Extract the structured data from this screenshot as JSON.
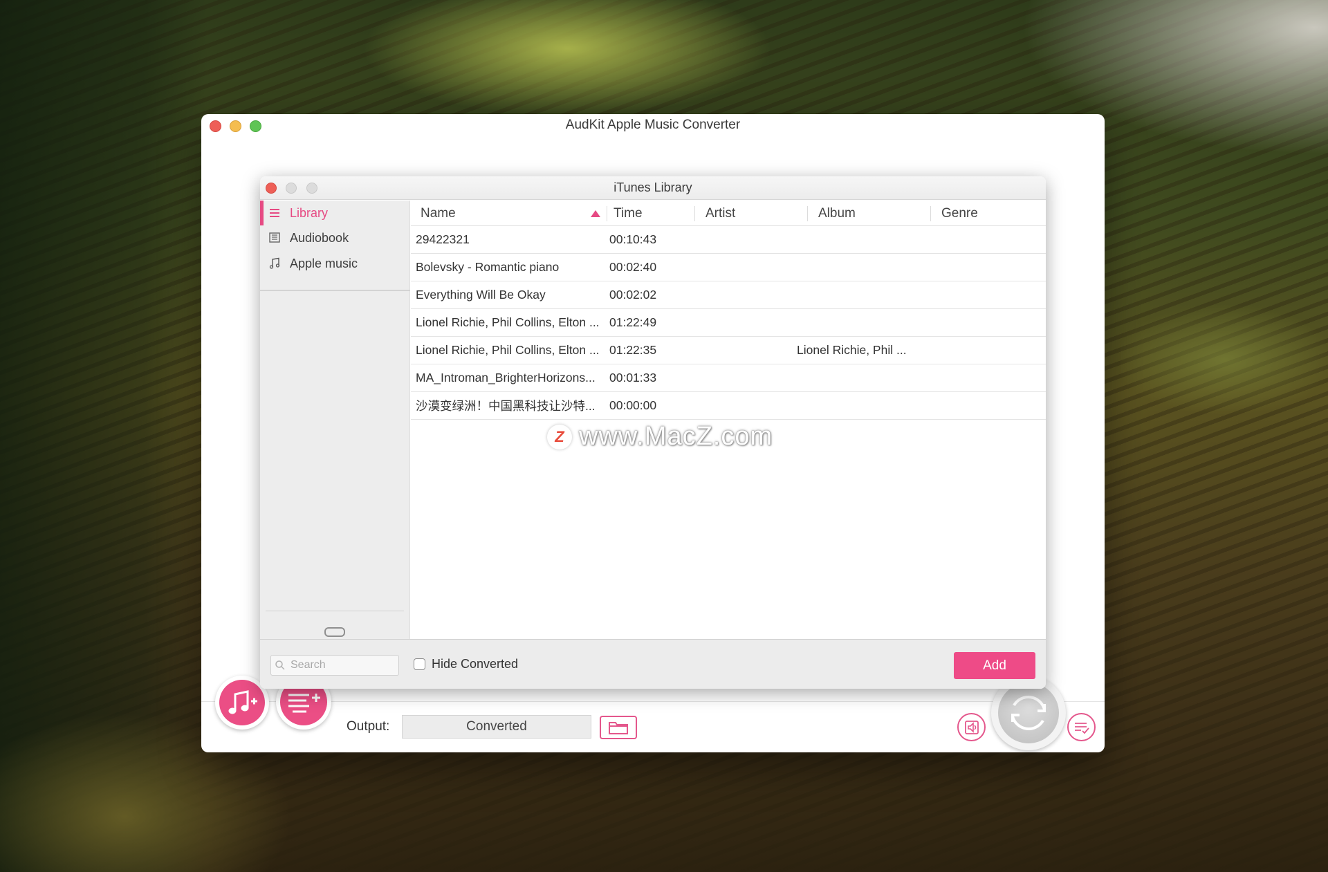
{
  "main_window": {
    "title": "AudKit Apple Music Converter",
    "output_label": "Output:",
    "output_value": "Converted"
  },
  "dialog": {
    "title": "iTunes Library",
    "sidebar": [
      {
        "label": "Library",
        "icon": "list-icon",
        "active": true
      },
      {
        "label": "Audiobook",
        "icon": "book-icon",
        "active": false
      },
      {
        "label": "Apple music",
        "icon": "music-note-icon",
        "active": false
      }
    ],
    "columns": [
      "Name",
      "Time",
      "Artist",
      "Album",
      "Genre"
    ],
    "sort": {
      "column": "Name",
      "direction": "ascending"
    },
    "rows": [
      {
        "name": "29422321",
        "time": "00:10:43",
        "artist": "",
        "album": "",
        "genre": ""
      },
      {
        "name": "Bolevsky - Romantic piano",
        "time": "00:02:40",
        "artist": "",
        "album": "",
        "genre": ""
      },
      {
        "name": "Everything Will Be Okay",
        "time": "00:02:02",
        "artist": "",
        "album": "",
        "genre": ""
      },
      {
        "name": "Lionel Richie, Phil Collins, Elton ...",
        "time": "01:22:49",
        "artist": "",
        "album": "",
        "genre": ""
      },
      {
        "name": "Lionel Richie, Phil Collins, Elton ...",
        "time": "01:22:35",
        "artist": "",
        "album": "Lionel Richie, Phil ...",
        "genre": ""
      },
      {
        "name": "MA_Introman_BrighterHorizons...",
        "time": "00:01:33",
        "artist": "",
        "album": "",
        "genre": ""
      },
      {
        "name": "沙漠变绿洲！中国黑科技让沙特...",
        "time": "00:00:00",
        "artist": "",
        "album": "",
        "genre": ""
      }
    ],
    "search_placeholder": "Search",
    "hide_converted_label": "Hide Converted",
    "hide_converted_checked": false,
    "add_label": "Add"
  },
  "watermark": {
    "badge": "Z",
    "text": "www.MacZ.com"
  },
  "colors": {
    "accent": "#ee4b87",
    "close": "#ee5f57",
    "minimize": "#f5bd4f",
    "maximize": "#5fc454"
  }
}
